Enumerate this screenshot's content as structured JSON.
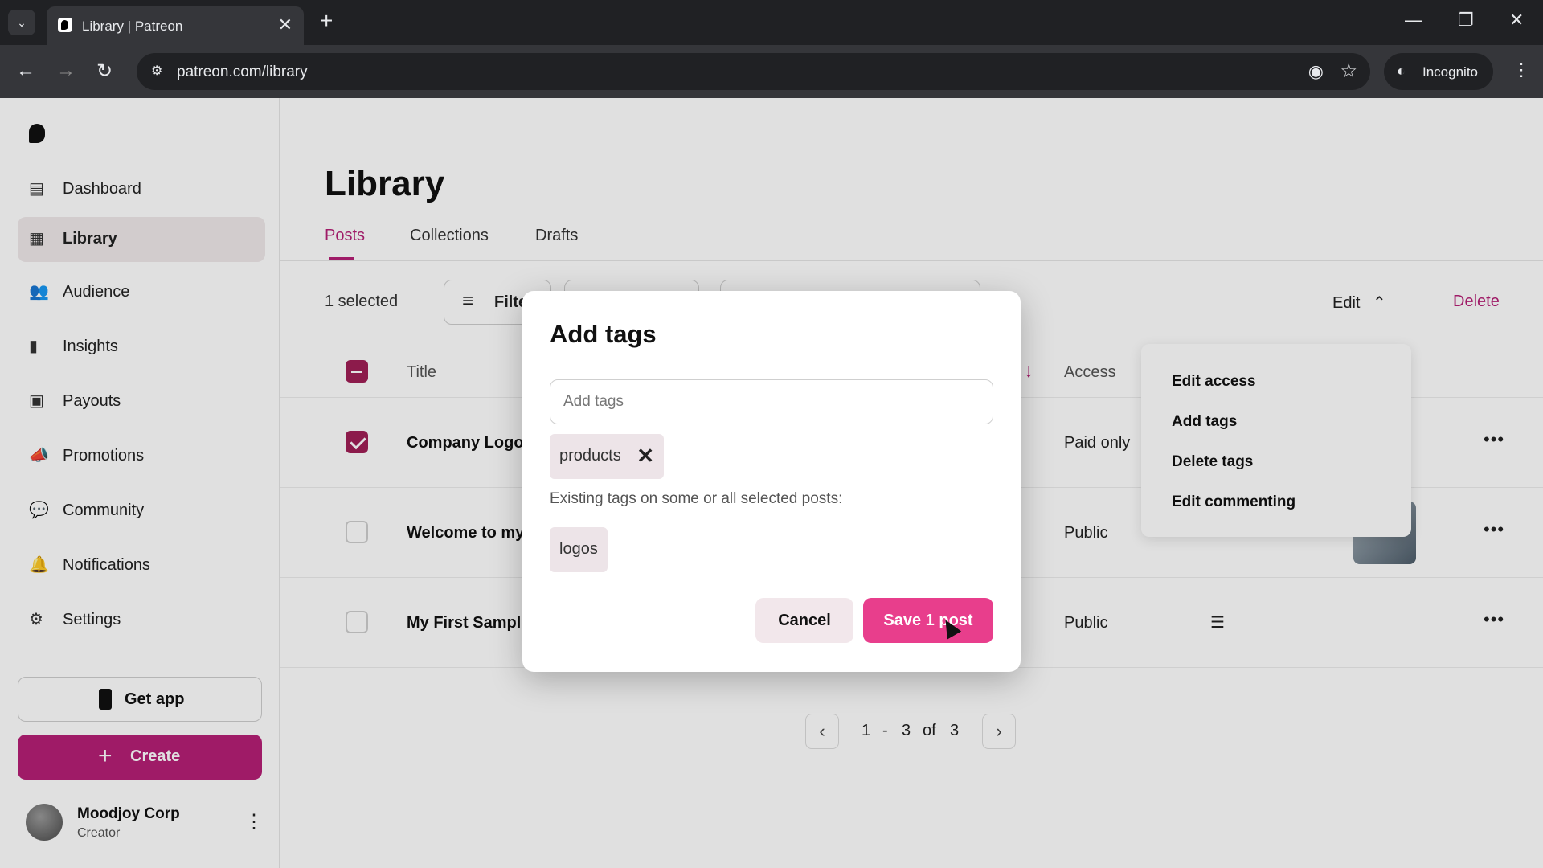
{
  "browser": {
    "tab_title": "Library | Patreon",
    "url": "patreon.com/library",
    "incognito_label": "Incognito"
  },
  "sidebar": {
    "items": [
      {
        "label": "Dashboard",
        "icon": "dashboard-icon"
      },
      {
        "label": "Library",
        "icon": "library-icon",
        "active": true
      },
      {
        "label": "Audience",
        "icon": "audience-icon"
      },
      {
        "label": "Insights",
        "icon": "insights-icon"
      },
      {
        "label": "Payouts",
        "icon": "payouts-icon"
      },
      {
        "label": "Promotions",
        "icon": "promotions-icon"
      },
      {
        "label": "Community",
        "icon": "community-icon"
      },
      {
        "label": "Notifications",
        "icon": "bell-icon"
      },
      {
        "label": "Settings",
        "icon": "gear-icon"
      }
    ],
    "get_app_label": "Get app",
    "create_label": "Create",
    "profile": {
      "name": "Moodjoy Corp",
      "role": "Creator"
    }
  },
  "main": {
    "title": "Library",
    "tabs": [
      {
        "label": "Posts",
        "active": true
      },
      {
        "label": "Collections"
      },
      {
        "label": "Drafts"
      }
    ],
    "selected_count": "1 selected",
    "filter_label": "Filte",
    "edit_label": "Edit",
    "delete_label": "Delete",
    "columns": {
      "title": "Title",
      "access": "Access"
    },
    "rows": [
      {
        "title": "Company Logos",
        "access": "Paid only",
        "checked": true
      },
      {
        "title": "Welcome to my I",
        "access": "Public",
        "checked": false
      },
      {
        "title": "My First Sample",
        "access": "Public",
        "checked": false
      }
    ],
    "pagination": {
      "start": "1",
      "dash": "-",
      "end": "3",
      "of": "of",
      "total": "3"
    }
  },
  "edit_menu": {
    "items": [
      "Edit access",
      "Add tags",
      "Delete tags",
      "Edit commenting"
    ]
  },
  "modal": {
    "title": "Add tags",
    "input_placeholder": "Add tags",
    "new_tags": [
      "products"
    ],
    "existing_label": "Existing tags on some or all selected posts:",
    "existing_tags": [
      "logos"
    ],
    "cancel_label": "Cancel",
    "save_label": "Save 1 post"
  },
  "colors": {
    "brand": "#b61f76",
    "save_button": "#e83e8c",
    "checkbox": "#a01f56"
  }
}
